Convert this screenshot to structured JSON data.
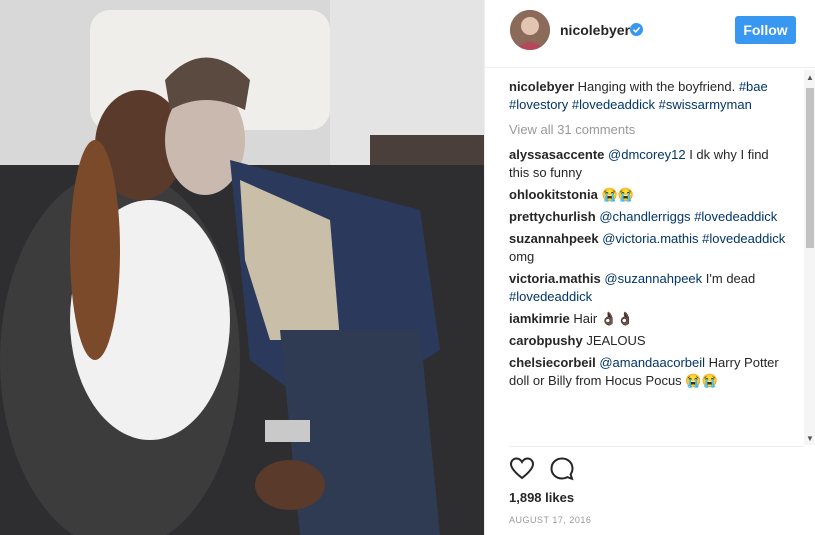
{
  "post": {
    "photo_alt": "Photo of two people sitting on a couch",
    "header": {
      "username": "nicolebyer",
      "follow_label": "Follow"
    },
    "caption": {
      "username": "nicolebyer",
      "text": "Hanging with the boyfriend.",
      "hashtags": [
        "#bae",
        "#lovestory",
        "#lovedeaddick",
        "#swissarmyman"
      ]
    },
    "view_all_comments": "View all 31 comments",
    "comments": [
      {
        "user": "alyssasaccente",
        "mention": "@dmcorey12",
        "text": "I dk why I find this so funny"
      },
      {
        "user": "ohlookitstonia",
        "text": "😭😭"
      },
      {
        "user": "prettychurlish",
        "mention": "@chandlerriggs",
        "tag": "#lovedeaddick"
      },
      {
        "user": "suzannahpeek",
        "mention": "@victoria.mathis",
        "tag": "#lovedeaddick",
        "text": "omg"
      },
      {
        "user": "victoria.mathis",
        "mention": "@suzannahpeek",
        "text": "I'm dead",
        "tag": "#lovedeaddick"
      },
      {
        "user": "iamkimrie",
        "text": "Hair 👌🏿👌🏿"
      },
      {
        "user": "carobpushy",
        "text": "JEALOUS"
      },
      {
        "user": "chelsiecorbeil",
        "mention": "@amandaacorbeil",
        "text": "Harry Potter doll or Billy from Hocus Pocus 😭😭"
      }
    ],
    "likes": "1,898 likes",
    "date": "AUGUST 17, 2016",
    "icons": {
      "verified": "verified-badge-icon",
      "like": "heart-icon",
      "comment": "comment-icon"
    },
    "colors": {
      "follow_button": "#3897f0",
      "hashtag": "#003569",
      "muted": "#999999"
    }
  }
}
